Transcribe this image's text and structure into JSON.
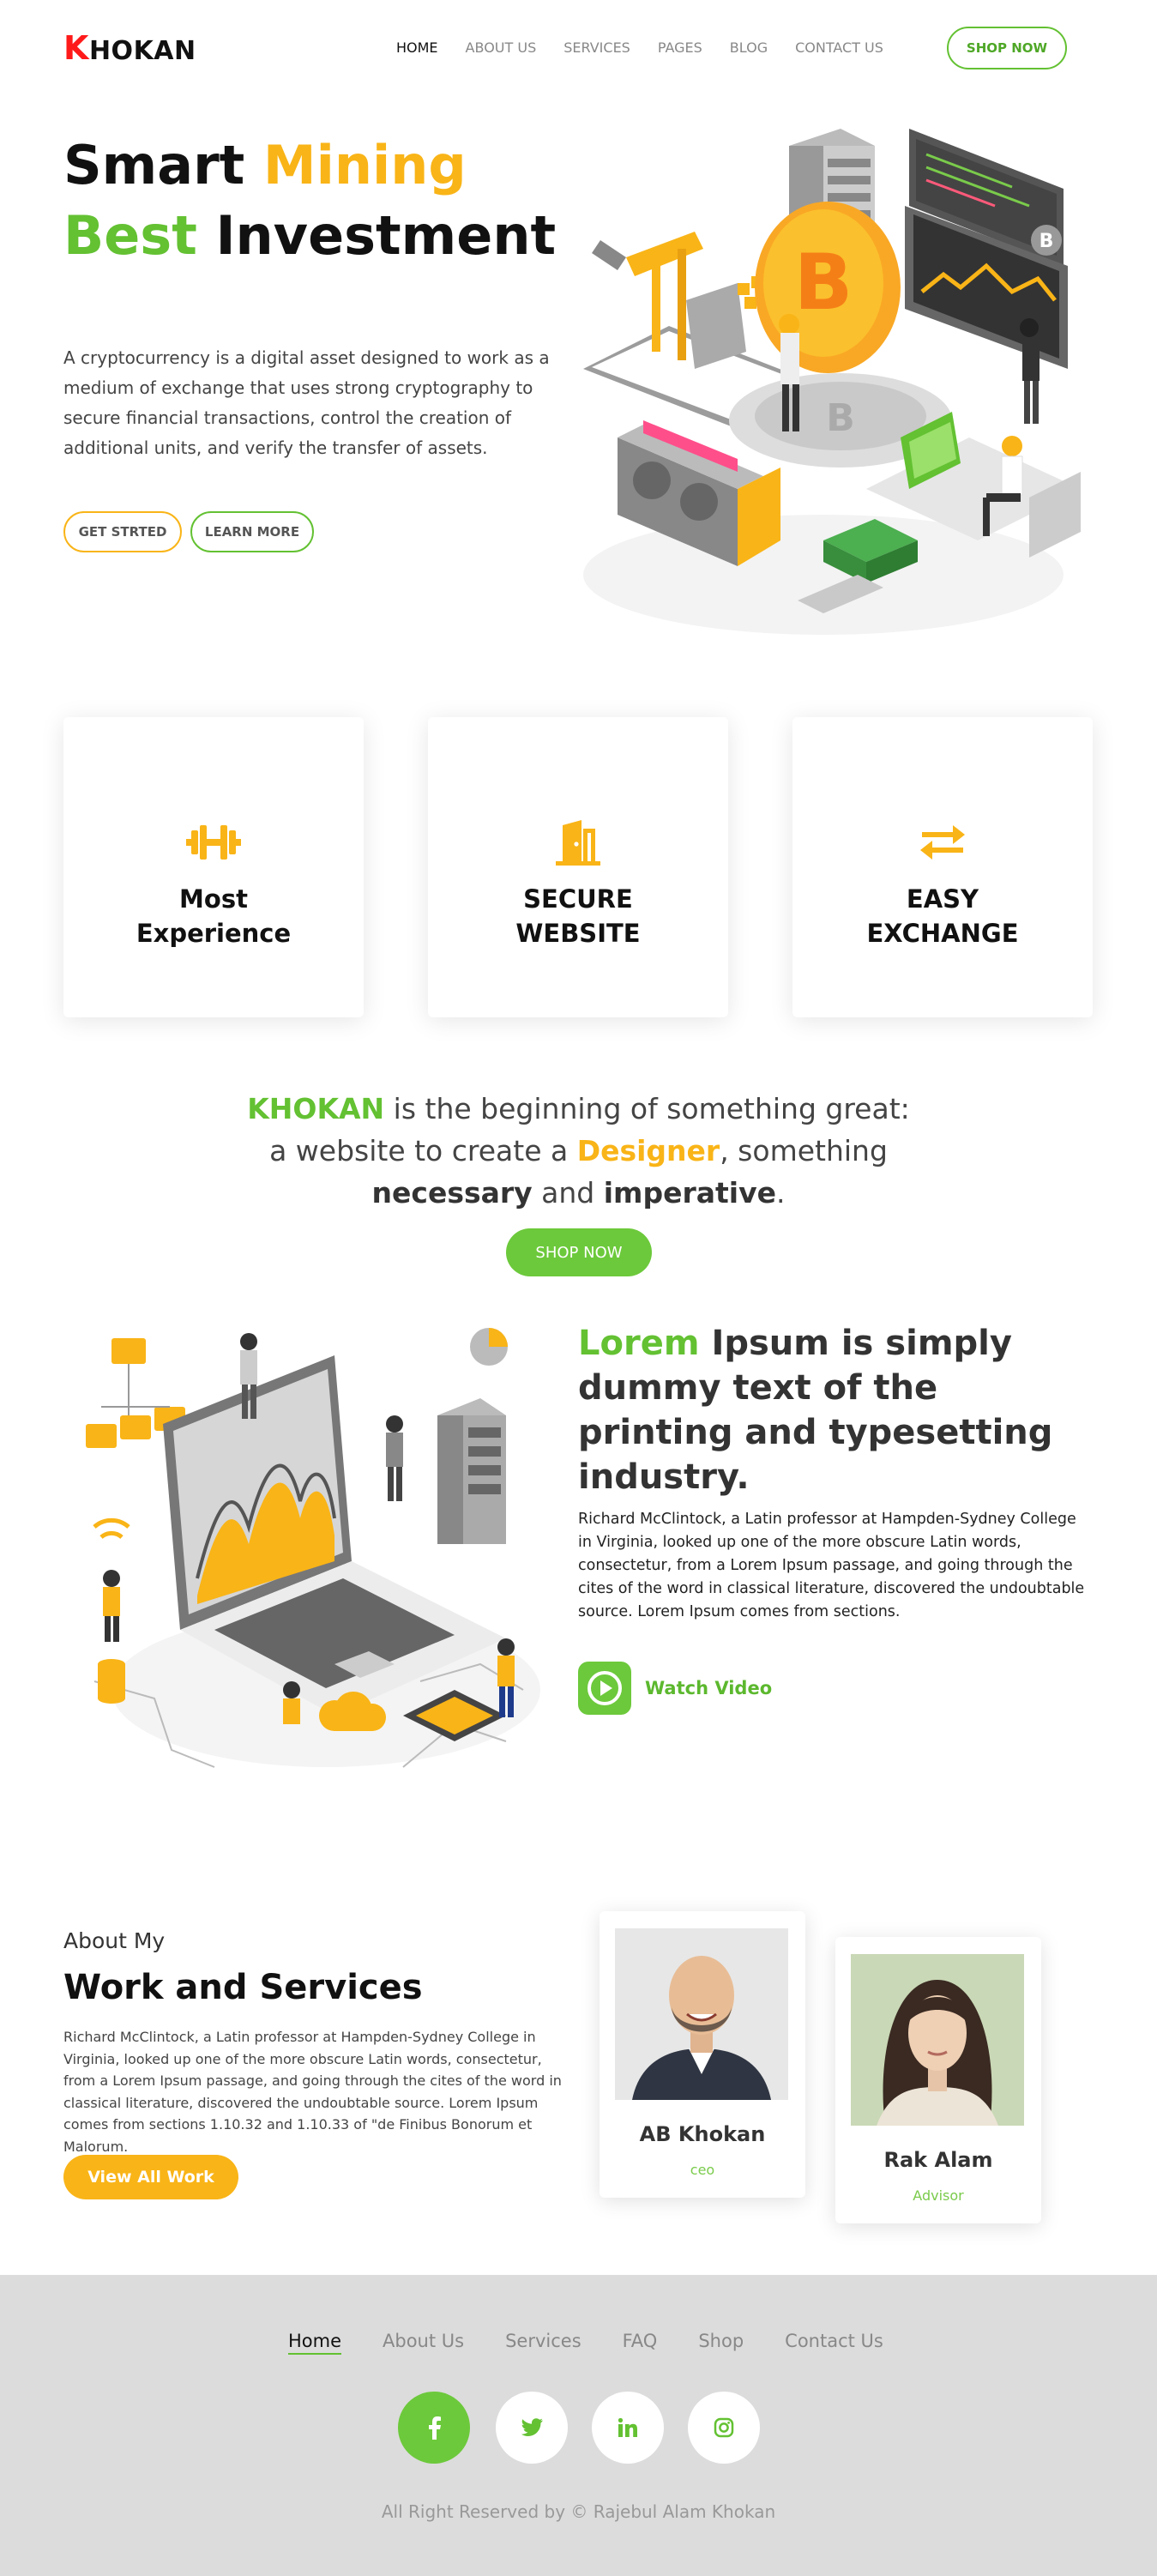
{
  "nav": {
    "logo_k": "K",
    "logo_rest": "HOKAN",
    "items": [
      "HOME",
      "ABOUT US",
      "SERVICES",
      "PAGES",
      "BLOG",
      "CONTACT US"
    ],
    "cta": "SHOP NOW"
  },
  "hero": {
    "title_smart": "Smart",
    "title_mining": "Mining",
    "title_best": "Best",
    "title_investment": "Investment",
    "text": "A cryptocurrency is a digital asset designed to work as a medium of exchange that uses strong cryptography to secure financial transactions, control the creation of additional units, and verify the transfer of assets.",
    "btn_start": "GET STRTED",
    "btn_learn": "LEARN MORE"
  },
  "features": [
    {
      "line1": "Most",
      "line2": "Experience",
      "icon": "dumbbell-icon"
    },
    {
      "line1": "SECURE",
      "line2": "WEBSITE",
      "icon": "door-icon"
    },
    {
      "line1": "EASY",
      "line2": "EXCHANGE",
      "icon": "exchange-arrows-icon"
    }
  ],
  "intro": {
    "brand": "KHOKAN",
    "p1": " is the beginning of something great:",
    "p2": "a website to create a ",
    "designer": "Designer",
    "p3": ", something",
    "necessary": "necessary",
    "and": " and ",
    "imperative": "imperative",
    "dot": ".",
    "cta": "SHOP NOW"
  },
  "about": {
    "heading_green": "Lorem",
    "heading_rest": " Ipsum is simply dummy text of the printing and typesetting industry.",
    "text": "Richard McClintock, a Latin professor at Hampden-Sydney College in Virginia, looked up one of the more obscure Latin words, consectetur, from a Lorem Ipsum passage, and going through the cites of the word in classical literature, discovered the undoubtable source. Lorem Ipsum comes from sections.",
    "watch": "Watch Video"
  },
  "work": {
    "kicker": "About My",
    "title": "Work and Services",
    "text": "Richard McClintock, a Latin professor at Hampden-Sydney College in Virginia, looked up one of the more obscure Latin words, consectetur, from a Lorem Ipsum passage, and going through the cites of the word in classical literature, discovered the undoubtable source. Lorem Ipsum comes from sections 1.10.32 and 1.10.33 of \"de Finibus Bonorum et Malorum.",
    "cta": "View All Work"
  },
  "team": [
    {
      "name": "AB Khokan",
      "role": "ceo"
    },
    {
      "name": "Rak Alam",
      "role": "Advisor"
    }
  ],
  "footer": {
    "menu": [
      "Home",
      "About Us",
      "Services",
      "FAQ",
      "Shop",
      "Contact Us"
    ],
    "social": [
      "facebook-icon",
      "twitter-icon",
      "linkedin-icon",
      "instagram-icon"
    ],
    "copyright": "All Right Reserved by © Rajebul Alam Khokan"
  },
  "colors": {
    "green": "#63c132",
    "yellow": "#f9b417",
    "logo_red": "#ff1a1a",
    "footer_bg": "#dcdcdc"
  }
}
